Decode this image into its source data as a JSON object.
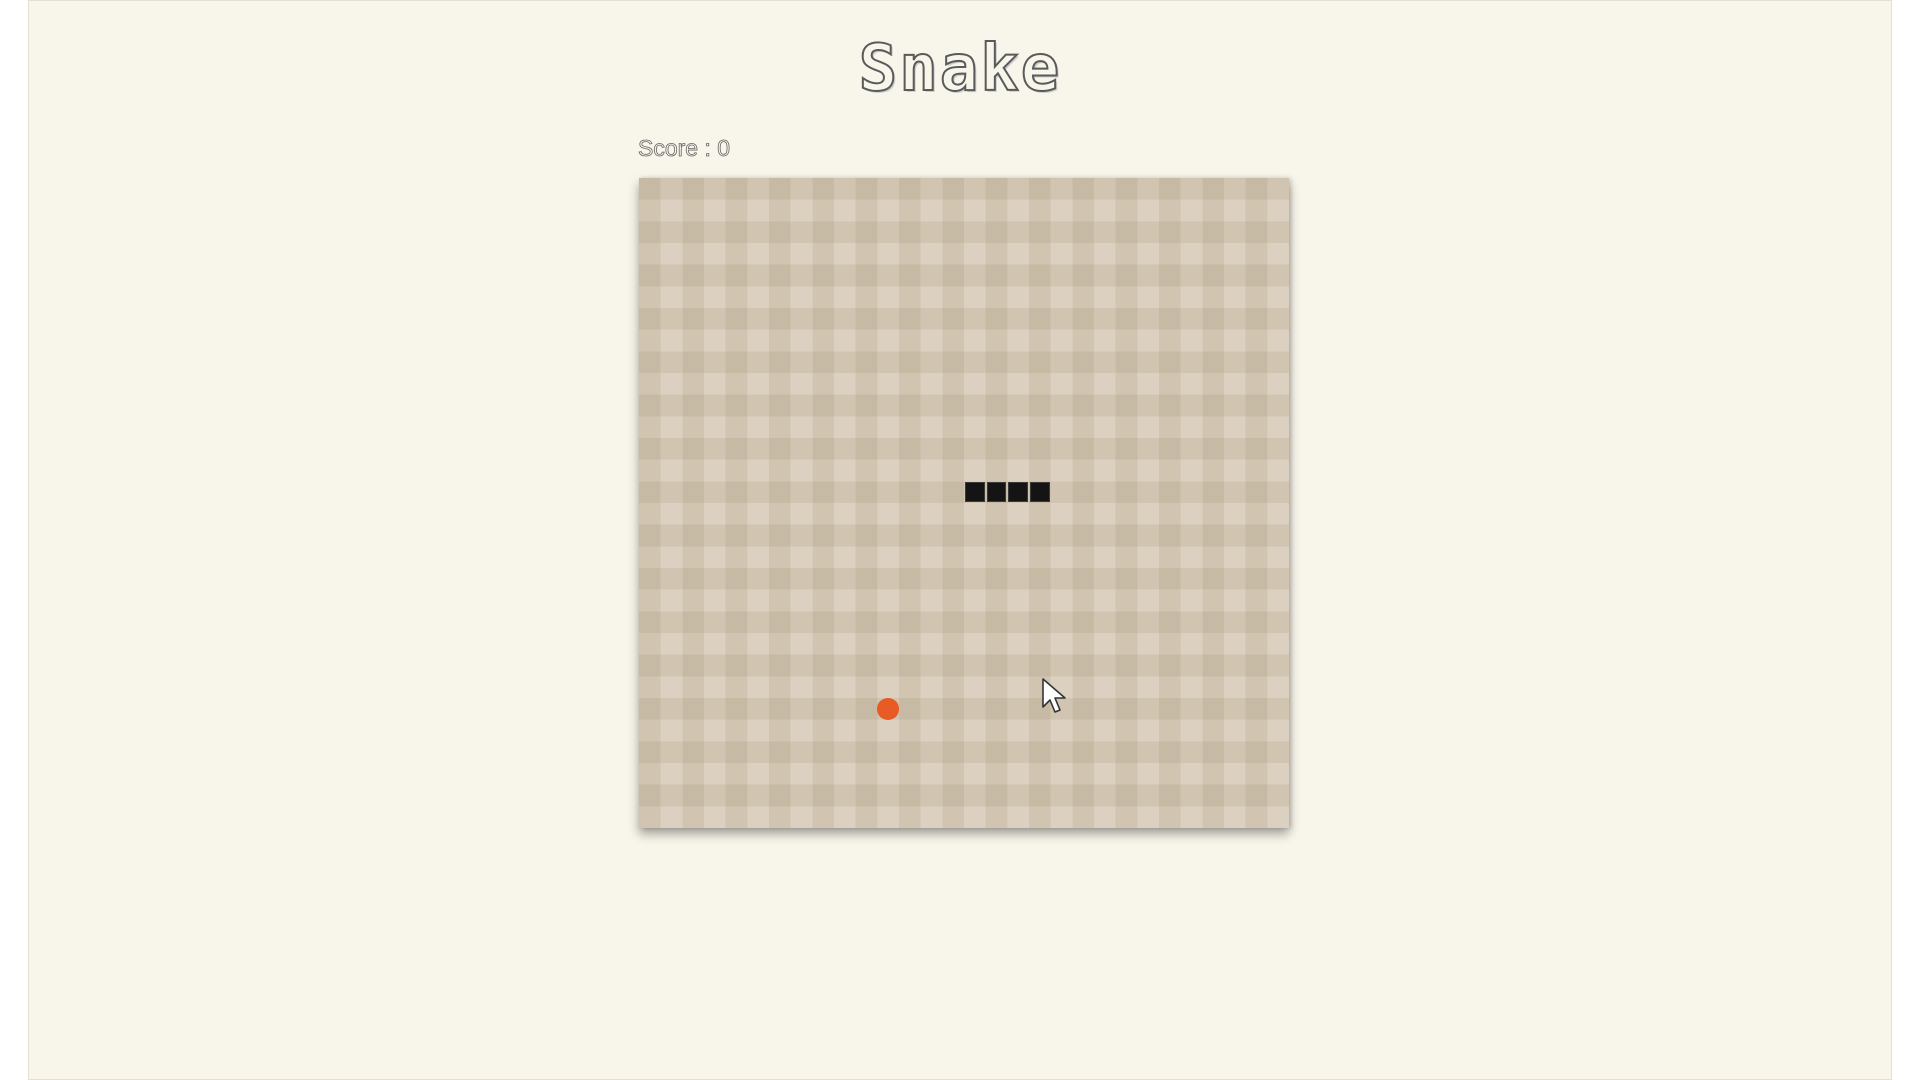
{
  "app": {
    "title": "Snake"
  },
  "score": {
    "label": "Score",
    "separator": " : ",
    "value": "0"
  },
  "board": {
    "columns": 30,
    "rows": 30,
    "colors": {
      "light": "#e3d9c9",
      "dark": "#c9bda9",
      "snake": "#141414",
      "food": "#e85b25"
    }
  },
  "snake": {
    "segments": [
      {
        "col": 15,
        "row": 14
      },
      {
        "col": 16,
        "row": 14
      },
      {
        "col": 17,
        "row": 14
      },
      {
        "col": 18,
        "row": 14
      }
    ]
  },
  "food": {
    "col": 11,
    "row": 24
  },
  "icons": {
    "cursor": "mouse-pointer-icon"
  }
}
